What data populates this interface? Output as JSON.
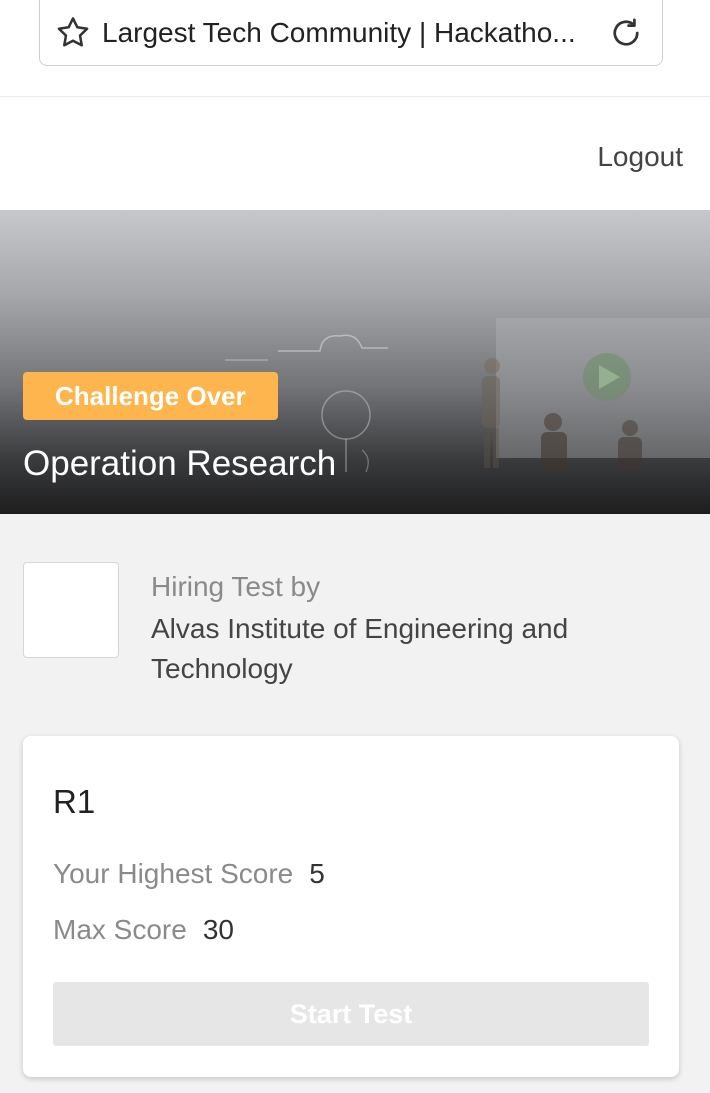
{
  "browser": {
    "tab_title": "Largest Tech Community | Hackatho...",
    "star_icon": "star-icon",
    "reload_icon": "reload-icon"
  },
  "header": {
    "logout_label": "Logout"
  },
  "hero": {
    "badge": "Challenge Over",
    "title": "Operation Research",
    "badge_color": "#ffb54d"
  },
  "organizer": {
    "label": "Hiring Test by",
    "name": "Alvas Institute of Engineering and Technology"
  },
  "round": {
    "title": "R1",
    "highest_score_label": "Your Highest Score",
    "highest_score_value": "5",
    "max_score_label": "Max Score",
    "max_score_value": "30",
    "start_button": "Start Test"
  }
}
